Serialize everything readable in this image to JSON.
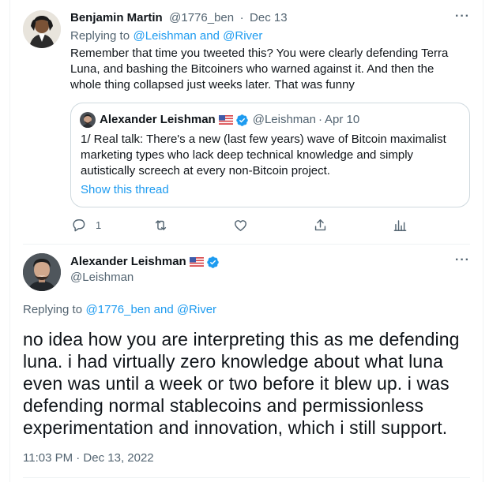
{
  "reply_tweet": {
    "author_name": "Benjamin Martin",
    "handle": "@1776_ben",
    "separator": "·",
    "date": "Dec 13",
    "replying_prefix": "Replying to",
    "replying_targets": "@Leishman and @River",
    "text_lines": [
      "Remember that time you tweeted this?  You were clearly defending Terra",
      "Luna, and bashing the Bitcoiners who warned against it.  And then the",
      "whole thing collapsed just weeks later.  That was funny"
    ],
    "more_label": "···",
    "quoted": {
      "author_name": "Alexander Leishman",
      "handle": "@Leishman",
      "date": "Apr 10",
      "text_lines": [
        "1/ Real talk: There's a new (last few years) wave of Bitcoin maximalist",
        "marketing types who lack deep technical knowledge and simply",
        "autistically screech at every non-Bitcoin project."
      ],
      "show_thread_label": "Show this thread"
    },
    "actions": {
      "reply_count": "1"
    }
  },
  "main_tweet": {
    "author_name": "Alexander Leishman",
    "handle": "@Leishman",
    "more_label": "···",
    "replying_prefix": "Replying to",
    "replying_targets": "@1776_ben and @River",
    "text_lines": [
      "no idea how you are interpreting this as me defending",
      "luna. i had virtually zero knowledge about what luna",
      "even was until a week or two before it blew up. i was",
      "defending normal stablecoins and permissionless",
      "experimentation and innovation, which i still support."
    ],
    "timestamp": "11:03 PM · Dec 13, 2022"
  },
  "colors": {
    "accent": "#1d9bf0",
    "muted": "#536471",
    "border": "#cfd9de"
  },
  "icons": [
    "user-avatar-icon",
    "verified-badge-icon",
    "us-flag-icon",
    "more-icon",
    "reply-icon",
    "retweet-icon",
    "like-icon",
    "share-icon",
    "analytics-icon"
  ]
}
